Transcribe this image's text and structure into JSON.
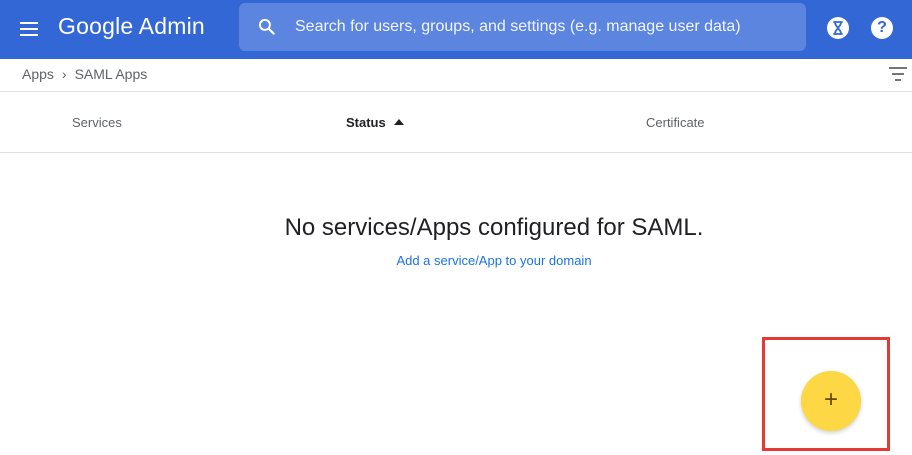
{
  "app": {
    "title": "Google Admin",
    "accent_color": "#3367d6"
  },
  "search": {
    "placeholder": "Search for users, groups, and settings (e.g. manage user data)"
  },
  "header_icons": {
    "hourglass": "hourglass-icon",
    "help": "?"
  },
  "breadcrumb": {
    "items": [
      "Apps",
      "SAML Apps"
    ],
    "separator": "›"
  },
  "table": {
    "columns": [
      {
        "label": "Services",
        "sorted": false
      },
      {
        "label": "Status",
        "sorted": true,
        "sort_direction": "ascending"
      },
      {
        "label": "Certificate",
        "sorted": false
      }
    ]
  },
  "empty_state": {
    "title": "No services/Apps configured for SAML.",
    "link": "Add a service/App to your domain"
  },
  "fab": {
    "label": "+",
    "color": "#fdd744",
    "highlight_color": "#e53935"
  }
}
